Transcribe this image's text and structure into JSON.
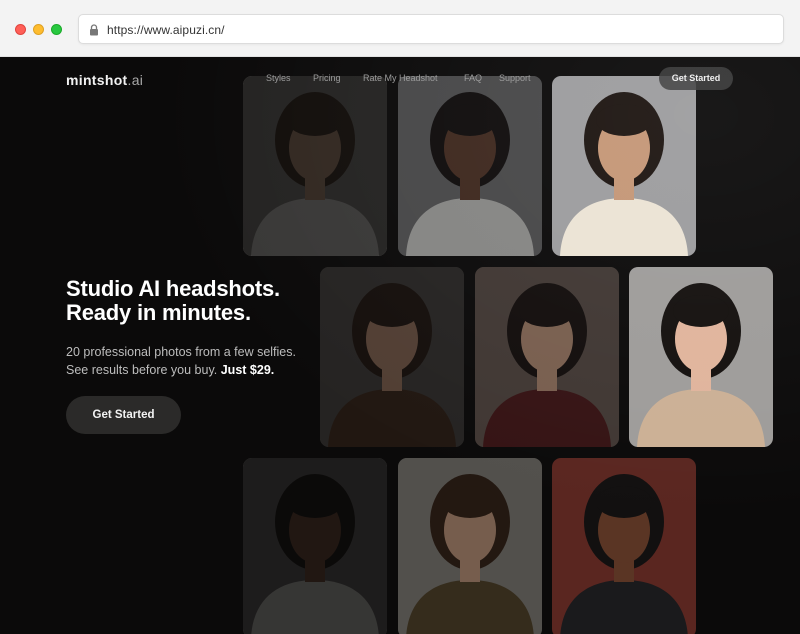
{
  "browser": {
    "url": "https://www.aipuzi.cn/"
  },
  "nav": {
    "logo_main": "mintshot",
    "logo_tld": ".ai",
    "items": [
      "Styles",
      "Pricing",
      "Rate My Headshot",
      "FAQ",
      "Support"
    ],
    "cta": "Get Started"
  },
  "hero": {
    "title_line1": "Studio AI headshots.",
    "title_line2": "Ready in minutes.",
    "sub_line1": "20 professional photos from a few selfies.",
    "sub_line2": "See results before you buy.",
    "sub_price": "Just $29.",
    "cta": "Get Started"
  },
  "gallery": {
    "photos": [
      {
        "subject": "woman with brown hair in white shirt",
        "bg": "#8a8580",
        "skin": "#c89a7c",
        "hair": "#3a2518",
        "top": "#e8e4de"
      },
      {
        "subject": "woman with curly black hair in white shirt",
        "bg": "#7a7a7c",
        "skin": "#6a4330",
        "hair": "#141010",
        "top": "#ecebe8"
      },
      {
        "subject": "man with dark hair in cream sweater",
        "bg": "#9c9c9e",
        "skin": "#c49676",
        "hair": "#1c1410",
        "top": "#ebe3d4"
      },
      {
        "subject": "woman with wavy dark hair",
        "bg": "#55504c",
        "skin": "#c8957a",
        "hair": "#2c1c14",
        "top": "#4a3020"
      },
      {
        "subject": "woman with long dark hair in burgundy top",
        "bg": "#6e5e56",
        "skin": "#d4a488",
        "hair": "#1a1210",
        "top": "#5a1c1e"
      },
      {
        "subject": "woman with black hair in beige blazer",
        "bg": "#9e9c9a",
        "skin": "#e0b49c",
        "hair": "#14100e",
        "top": "#cbb095"
      },
      {
        "subject": "woman with curly hair in white top",
        "bg": "#6a6664",
        "skin": "#7a4e36",
        "hair": "#1a1210",
        "top": "#dcd8d2"
      },
      {
        "subject": "man with brown hair in olive jacket",
        "bg": "#8e8a84",
        "skin": "#d0a286",
        "hair": "#3a2618",
        "top": "#5a4a2c"
      },
      {
        "subject": "man in black suit",
        "bg": "#5a2620",
        "skin": "#5a3524",
        "hair": "#121010",
        "top": "#1a1a1c"
      }
    ]
  }
}
